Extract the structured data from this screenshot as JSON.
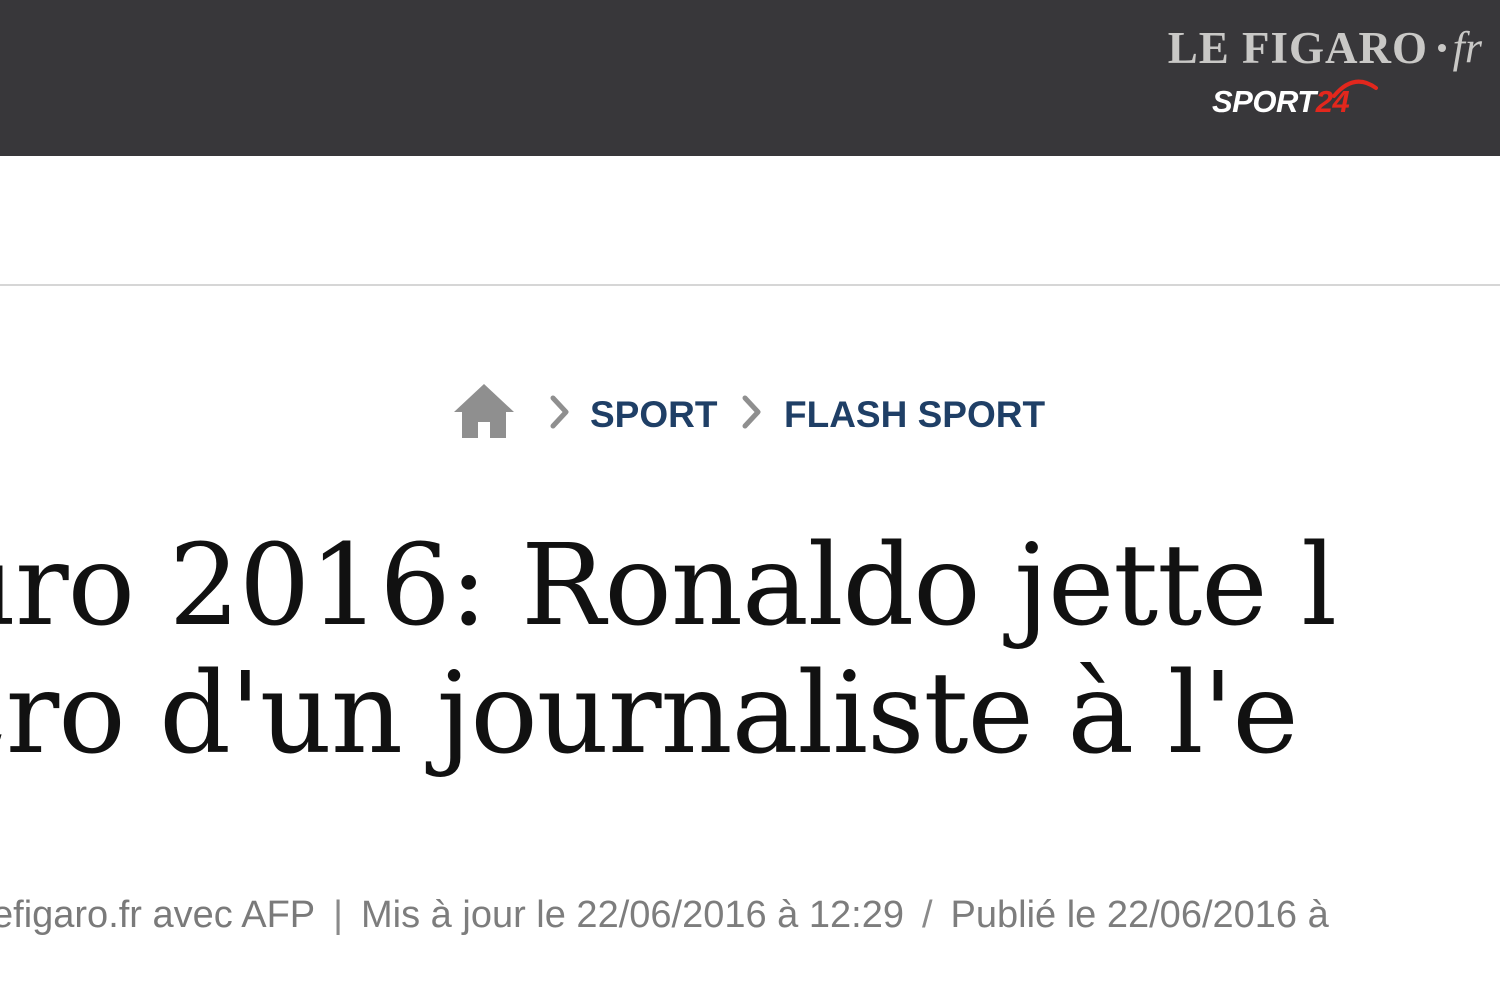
{
  "header": {
    "brand": "LE FIGARO",
    "brand_tld": "fr",
    "sub_brand_word": "SPORT",
    "sub_brand_num": "24",
    "colors": {
      "bar": "#38373a",
      "brand_text": "#c9c8c6",
      "accent_red": "#e2271d"
    }
  },
  "breadcrumb": {
    "home_icon": "home-icon",
    "items": [
      {
        "label": "SPORT"
      },
      {
        "label": "FLASH SPORT"
      }
    ],
    "link_color": "#1f3f66"
  },
  "article": {
    "headline_lines": [
      "uro 2016: Ronaldo jette l",
      "cro d'un journaliste à l'e"
    ],
    "byline": {
      "source": "efigaro.fr avec AFP",
      "separator": "|",
      "updated": "Mis à jour le 22/06/2016 à 12:29",
      "slash": "/",
      "published": "Publié le 22/06/2016 à"
    }
  }
}
